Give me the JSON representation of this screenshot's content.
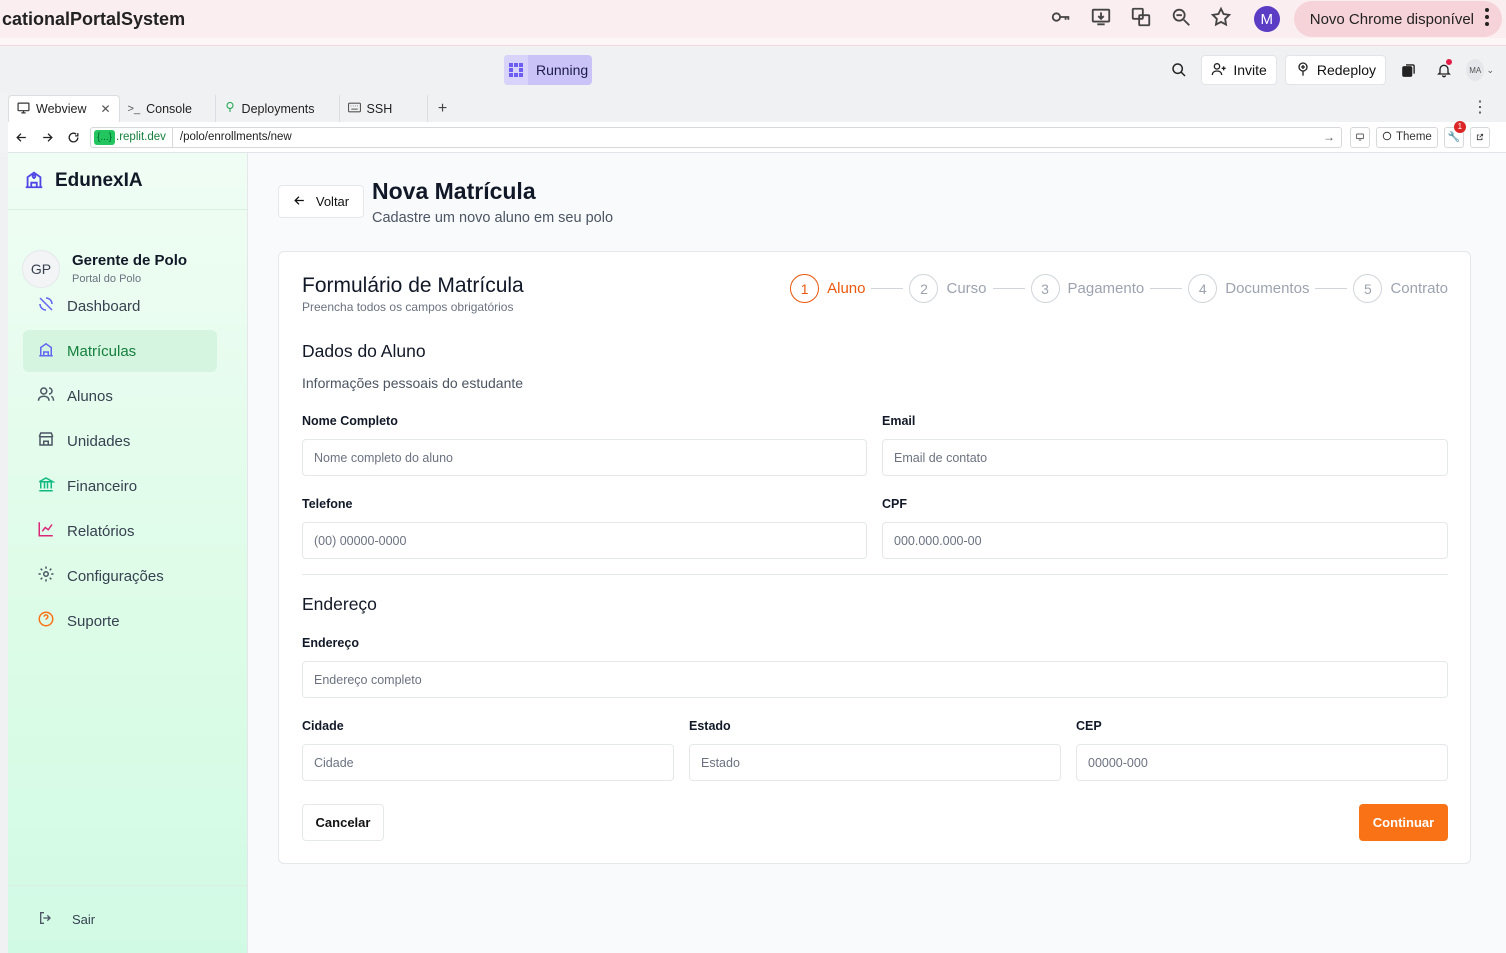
{
  "browser": {
    "page_title": "cationalPortalSystem",
    "update_label": "Novo Chrome disponível",
    "profile_initial": "M"
  },
  "replit": {
    "status": "Running",
    "invite_label": "Invite",
    "redeploy_label": "Redeploy",
    "avatar_initials": "MA",
    "tabs": [
      {
        "label": "Webview",
        "icon": "monitor-icon"
      },
      {
        "label": "Console",
        "icon": "terminal-icon"
      },
      {
        "label": "Deployments",
        "icon": "deploy-icon"
      },
      {
        "label": "SSH",
        "icon": "keyboard-icon"
      }
    ],
    "url_domain": ".replit.dev",
    "url_domain_badge": "{...}",
    "url_path": "/polo/enrollments/new",
    "theme_label": "Theme",
    "notif_count": "1"
  },
  "sidebar": {
    "brand": "EdunexIA",
    "user": {
      "initials": "GP",
      "name": "Gerente de Polo",
      "role": "Portal do Polo"
    },
    "items": [
      {
        "label": "Dashboard",
        "icon": "dashboard-icon",
        "color": "#6366f1"
      },
      {
        "label": "Matrículas",
        "icon": "school-icon",
        "color": "#6366f1"
      },
      {
        "label": "Alunos",
        "icon": "users-icon",
        "color": "#4b5563"
      },
      {
        "label": "Unidades",
        "icon": "store-icon",
        "color": "#4b5563"
      },
      {
        "label": "Financeiro",
        "icon": "bank-icon",
        "color": "#10b981"
      },
      {
        "label": "Relatórios",
        "icon": "chart-icon",
        "color": "#db2777"
      },
      {
        "label": "Configurações",
        "icon": "gear-icon",
        "color": "#4b5563"
      },
      {
        "label": "Suporte",
        "icon": "help-icon",
        "color": "#f97316"
      }
    ],
    "logout_label": "Sair"
  },
  "page": {
    "back_label": "Voltar",
    "title": "Nova Matrícula",
    "subtitle": "Cadastre um novo aluno em seu polo"
  },
  "form": {
    "title": "Formulário de Matrícula",
    "subtitle": "Preencha todos os campos obrigatórios",
    "steps": [
      {
        "num": "1",
        "label": "Aluno",
        "active": true
      },
      {
        "num": "2",
        "label": "Curso",
        "active": false
      },
      {
        "num": "3",
        "label": "Pagamento",
        "active": false
      },
      {
        "num": "4",
        "label": "Documentos",
        "active": false
      },
      {
        "num": "5",
        "label": "Contrato",
        "active": false
      }
    ],
    "student_section": {
      "title": "Dados do Aluno",
      "description": "Informações pessoais do estudante"
    },
    "fields": {
      "name": {
        "label": "Nome Completo",
        "placeholder": "Nome completo do aluno",
        "value": ""
      },
      "email": {
        "label": "Email",
        "placeholder": "Email de contato",
        "value": ""
      },
      "phone": {
        "label": "Telefone",
        "placeholder": "(00) 00000-0000",
        "value": ""
      },
      "cpf": {
        "label": "CPF",
        "placeholder": "000.000.000-00",
        "value": ""
      },
      "address": {
        "label": "Endereço",
        "placeholder": "Endereço completo",
        "value": ""
      },
      "city": {
        "label": "Cidade",
        "placeholder": "Cidade",
        "value": ""
      },
      "state": {
        "label": "Estado",
        "placeholder": "Estado",
        "value": ""
      },
      "zip": {
        "label": "CEP",
        "placeholder": "00000-000",
        "value": ""
      }
    },
    "address_section": {
      "title": "Endereço"
    },
    "cancel_label": "Cancelar",
    "continue_label": "Continuar"
  },
  "colors": {
    "accent": "#f97316",
    "active_nav": "#15803d",
    "running": "#c9c3f7"
  }
}
